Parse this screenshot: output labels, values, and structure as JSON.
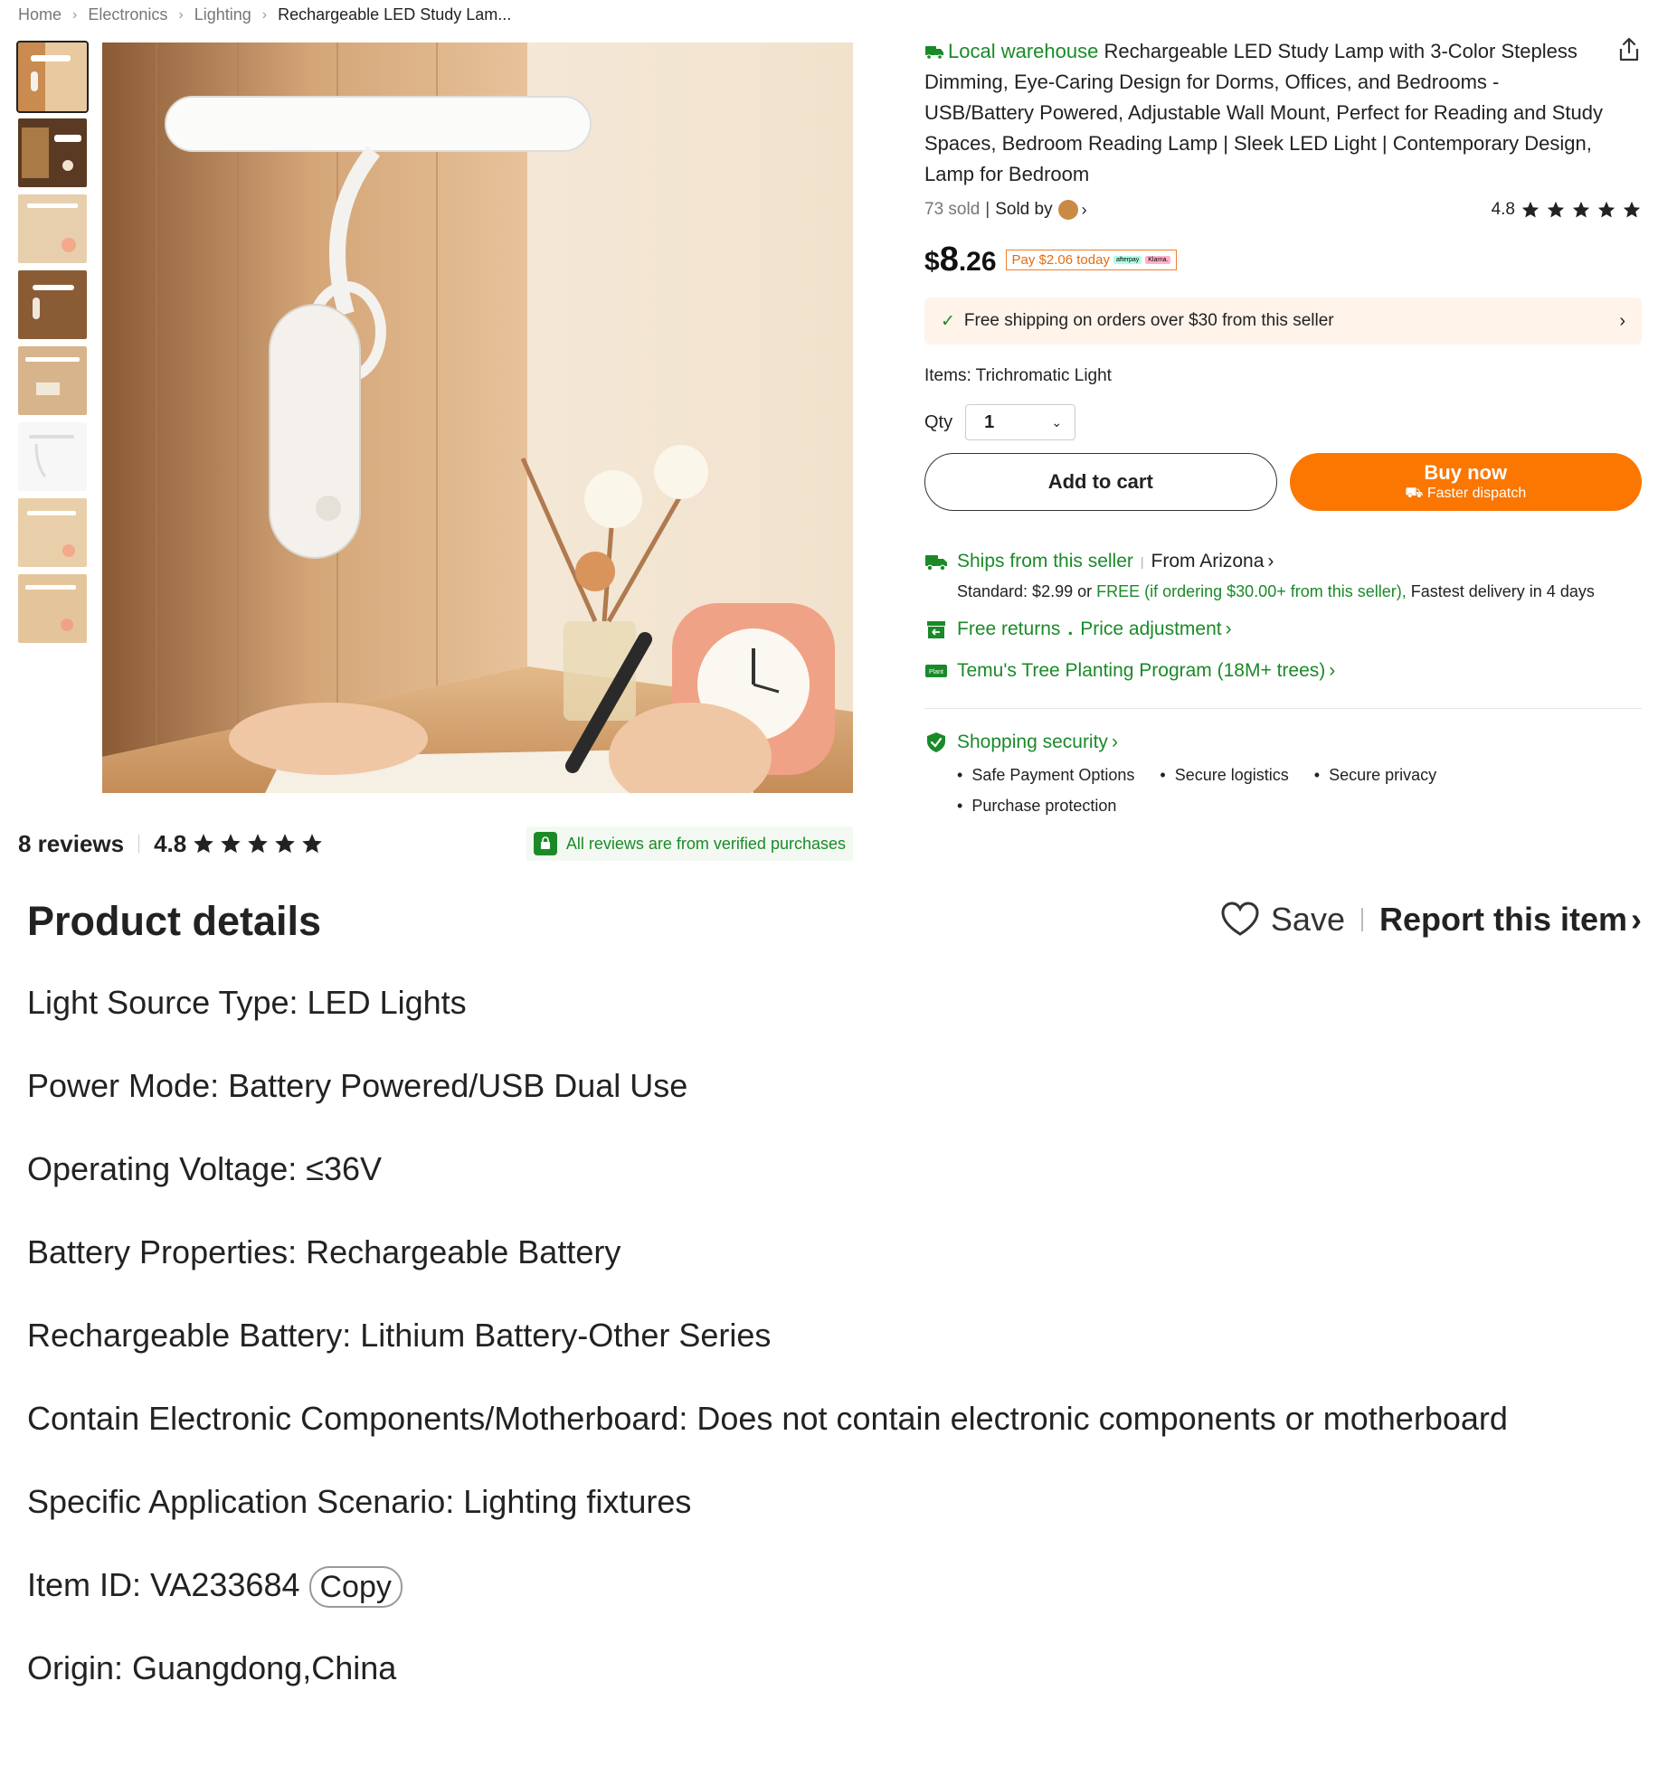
{
  "breadcrumb": [
    "Home",
    "Electronics",
    "Lighting",
    "Rechargeable LED Study Lam..."
  ],
  "thumbnails": 8,
  "reviews": {
    "count_label": "8 reviews",
    "rating": "4.8",
    "verified_text": "All reviews are from verified purchases"
  },
  "product": {
    "badge": "Local warehouse",
    "title": "Rechargeable LED Study Lamp with 3-Color Stepless Dimming, Eye-Caring Design for Dorms, Offices, and Bedrooms - USB/Battery Powered, Adjustable Wall Mount, Perfect for Reading and Study Spaces, Bedroom Reading Lamp | Sleek LED Light | Contemporary Design, Lamp for Bedroom",
    "sold": "73 sold",
    "sold_by": "Sold by",
    "rating": "4.8",
    "price": {
      "currency": "$",
      "whole": "8",
      "cents": ".26"
    },
    "pay_today": "Pay $2.06 today",
    "pay_logos": [
      "afterpay",
      "Klarna."
    ],
    "shipping_banner": "Free shipping on orders over $30 from this seller",
    "items_label": "Items: Trichromatic Light",
    "qty_label": "Qty",
    "qty_value": "1",
    "add_to_cart": "Add to cart",
    "buy_now": "Buy now",
    "faster_dispatch": "Faster dispatch"
  },
  "shipping": {
    "ships_from": "Ships from this seller",
    "origin": "From Arizona",
    "standard_prefix": "Standard: $2.99 or ",
    "free_text": "FREE (if ordering $30.00+ from this seller),",
    "fastest": " Fastest delivery in 4 days",
    "free_returns": "Free returns",
    "price_adjustment": "Price adjustment",
    "tree_program": "Temu's Tree Planting Program (18M+ trees)"
  },
  "security": {
    "title": "Shopping security",
    "items": [
      "Safe Payment Options",
      "Secure logistics",
      "Secure privacy",
      "Purchase protection"
    ]
  },
  "details": {
    "heading": "Product details",
    "save": "Save",
    "report": "Report this item",
    "rows": [
      "Light Source Type: LED Lights",
      "Power Mode: Battery Powered/USB Dual Use",
      "Operating Voltage: ≤36V",
      "Battery Properties: Rechargeable Battery",
      "Rechargeable Battery: Lithium Battery-Other Series",
      "Contain Electronic Components/Motherboard: Does not contain electronic components or motherboard",
      "Specific Application Scenario: Lighting fixtures"
    ],
    "item_id": "Item ID: VA233684",
    "copy": "Copy",
    "origin": "Origin: Guangdong,China"
  },
  "colors": {
    "green": "#1a8a28",
    "orange": "#fb7701",
    "banner": "#fff3ea"
  },
  "icons": [
    "share-icon",
    "star-icon",
    "truck-icon",
    "return-icon",
    "plant-icon",
    "shield-icon",
    "heart-icon",
    "chevron-right-icon",
    "chevron-down-icon",
    "check-icon"
  ]
}
